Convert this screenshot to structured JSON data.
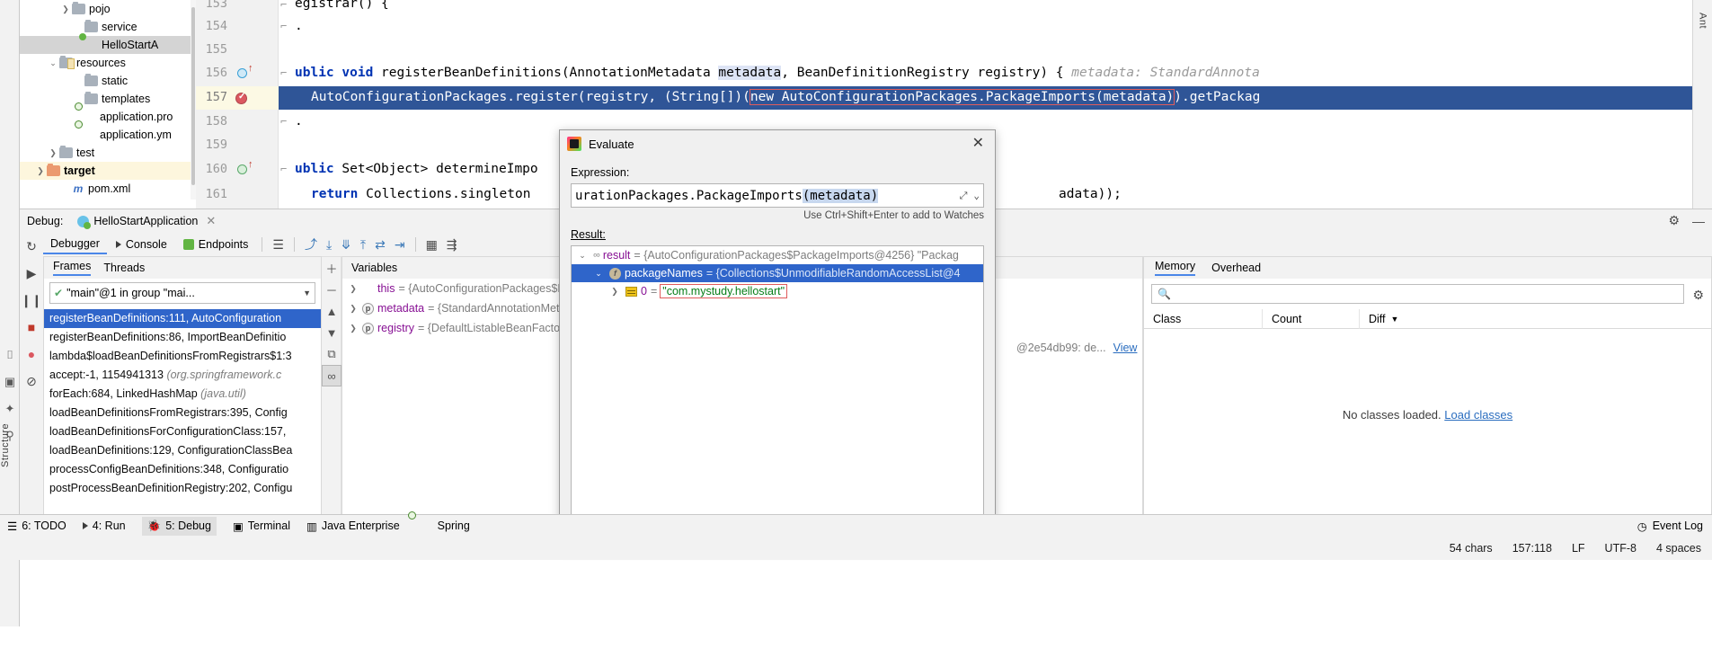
{
  "window": {
    "left_rail_vertical_text": "Structure",
    "right_rail_vertical_text": "Ant"
  },
  "project_tree": {
    "items": [
      {
        "label": "pojo",
        "icon": "folder-icon",
        "arrow": "chevron-right",
        "indent": 3,
        "state": "normal"
      },
      {
        "label": "service",
        "icon": "folder-icon",
        "arrow": "",
        "indent": 4,
        "state": "normal"
      },
      {
        "label": "HelloStartA",
        "icon": "java-class-icon",
        "arrow": "",
        "indent": 4,
        "state": "selected"
      },
      {
        "label": "resources",
        "icon": "resources-folder-icon",
        "arrow": "chevron-down",
        "indent": 2,
        "state": "normal"
      },
      {
        "label": "static",
        "icon": "folder-icon",
        "arrow": "",
        "indent": 4,
        "state": "normal"
      },
      {
        "label": "templates",
        "icon": "folder-icon",
        "arrow": "",
        "indent": 4,
        "state": "normal"
      },
      {
        "label": "application.pro",
        "icon": "spring-leaf-icon",
        "arrow": "",
        "indent": 3,
        "state": "normal"
      },
      {
        "label": "application.ym",
        "icon": "spring-leaf-icon",
        "arrow": "",
        "indent": 3,
        "state": "normal"
      },
      {
        "label": "test",
        "icon": "folder-icon",
        "arrow": "chevron-right",
        "indent": 1,
        "state": "normal"
      },
      {
        "label": "target",
        "icon": "target-folder-icon",
        "arrow": "chevron-right",
        "indent": 1,
        "state": "highlight"
      },
      {
        "label": "pom.xml",
        "icon": "maven-pom-icon",
        "arrow": "",
        "indent": 2,
        "state": "normal"
      }
    ]
  },
  "editor": {
    "lines": [
      {
        "num": "153",
        "text": "egistrar() {",
        "markers": []
      },
      {
        "num": "154",
        "text": "",
        "markers": []
      },
      {
        "num": "155",
        "text": "",
        "markers": []
      },
      {
        "num": "156",
        "text": "ublic void registerBeanDefinitions(AnnotationMetadata metadata, BeanDefinitionRegistry registry) {",
        "markers": [
          "run-icon-blue",
          "arrow-up-icon"
        ]
      },
      {
        "num": "157",
        "text": "AutoConfigurationPackages.register(registry, (String[])(new AutoConfigurationPackages.PackageImports(metadata)).getPackag",
        "markers": [
          "breakpoint-icon"
        ]
      },
      {
        "num": "158",
        "text": "",
        "markers": []
      },
      {
        "num": "159",
        "text": "",
        "markers": []
      },
      {
        "num": "160",
        "text": "ublic Set<Object> determineImpo",
        "markers": [
          "run-icon-green",
          "arrow-up-icon"
        ]
      },
      {
        "num": "161",
        "text": "return Collections.singleton",
        "markers": []
      }
    ],
    "line156": {
      "kw1": "ublic",
      "kw2": "void",
      "sig_a": " registerBeanDefinitions(AnnotationMetadata ",
      "highlight_ident": "metadata",
      "sig_b": ", BeanDefinitionRegistry registry) { ",
      "inlay_hint": "metadata: StandardAnnota"
    },
    "line157": {
      "part_a": "AutoConfigurationPackages.register(registry, (String[])(",
      "boxed": "new AutoConfigurationPackages.PackageImports(metadata)",
      "part_b": ").getPackag"
    },
    "line160": {
      "kw1": "ublic",
      "rest": " Set<Object> determineImpo"
    },
    "line161": {
      "kw": "return",
      "rest": " Collections.singleton",
      "tail": "adata));"
    }
  },
  "debug": {
    "header_label": "Debug:",
    "session_tab": "HelloStartApplication",
    "tabs": [
      {
        "label": "Debugger",
        "icon": "",
        "active": true
      },
      {
        "label": "Console",
        "icon": "play-triangle-icon",
        "active": false
      },
      {
        "label": "Endpoints",
        "icon": "endpoints-icon",
        "active": false
      }
    ],
    "frames": {
      "tab_frames": "Frames",
      "tab_threads": "Threads",
      "thread_selector": "\"main\"@1 in group \"mai...",
      "rows": [
        {
          "text": "registerBeanDefinitions:111, AutoConfiguration",
          "italic": "",
          "selected": true
        },
        {
          "text": "registerBeanDefinitions:86, ImportBeanDefinitio",
          "italic": "",
          "selected": false
        },
        {
          "text": "lambda$loadBeanDefinitionsFromRegistrars$1:3",
          "italic": "",
          "selected": false
        },
        {
          "text": "accept:-1, 1154941313 ",
          "italic": "(org.springframework.c",
          "selected": false
        },
        {
          "text": "forEach:684, LinkedHashMap ",
          "italic": "(java.util)",
          "selected": false
        },
        {
          "text": "loadBeanDefinitionsFromRegistrars:395, Config",
          "italic": "",
          "selected": false
        },
        {
          "text": "loadBeanDefinitionsForConfigurationClass:157, ",
          "italic": "",
          "selected": false
        },
        {
          "text": "loadBeanDefinitions:129, ConfigurationClassBea",
          "italic": "",
          "selected": false
        },
        {
          "text": "processConfigBeanDefinitions:348, Configuratio",
          "italic": "",
          "selected": false
        },
        {
          "text": "postProcessBeanDefinitionRegistry:202, Configu",
          "italic": "",
          "selected": false
        }
      ]
    },
    "variables": {
      "title": "Variables",
      "rows": [
        {
          "name": "this",
          "value": "= {AutoConfigurationPackages$R",
          "badge": ""
        },
        {
          "name": "metadata",
          "value": "= {StandardAnnotationMet",
          "badge": "p"
        },
        {
          "name": "registry",
          "value": "= {DefaultListableBeanFactor",
          "badge": "p"
        }
      ],
      "overflow_text": "@2e54db99: de...",
      "overflow_link": "View"
    },
    "memory": {
      "tabs": [
        {
          "label": "Memory",
          "active": true
        },
        {
          "label": "Overhead",
          "active": false
        }
      ],
      "search_placeholder": "",
      "columns": [
        "Class",
        "Count",
        "Diff"
      ],
      "empty_text": "No classes loaded.",
      "empty_link": "Load classes"
    }
  },
  "evaluate_dialog": {
    "title": "Evaluate",
    "close_label": "✕",
    "expression_label": "Expression:",
    "expression_prefix": "urationPackages.PackageImports",
    "expression_selected": "(metadata)",
    "hint": "Use Ctrl+Shift+Enter to add to Watches",
    "result_label": "Result:",
    "rows": [
      {
        "indent": 0,
        "arrow": "chevron-down",
        "icon": "oo-icon",
        "name": "result",
        "value": "= {AutoConfigurationPackages$PackageImports@4256} \"Packag",
        "selected": false
      },
      {
        "indent": 1,
        "arrow": "chevron-down",
        "icon": "field-icon",
        "name": "packageNames",
        "value": "= {Collections$UnmodifiableRandomAccessList@4",
        "selected": true
      },
      {
        "indent": 2,
        "arrow": "chevron-right",
        "icon": "array-index-icon",
        "name": "0",
        "value": "= ",
        "string_value": "\"com.mystudy.hellostart\"",
        "selected": false,
        "boxed": true
      }
    ]
  },
  "bottom_toolbar": {
    "items": [
      {
        "label": "6: TODO",
        "icon": "todo-icon",
        "active": false
      },
      {
        "label": "4: Run",
        "icon": "run-icon",
        "active": false
      },
      {
        "label": "5: Debug",
        "icon": "debug-bug-icon",
        "active": true
      },
      {
        "label": "Terminal",
        "icon": "terminal-icon",
        "active": false
      },
      {
        "label": "Java Enterprise",
        "icon": "java-ee-icon",
        "active": false
      },
      {
        "label": "Spring",
        "icon": "spring-leaf-icon",
        "active": false
      }
    ],
    "event_log": "Event Log"
  },
  "status_bar": {
    "chars": "54 chars",
    "caret": "157:118",
    "line_sep": "LF",
    "encoding": "UTF-8",
    "indent": "4 spaces"
  }
}
